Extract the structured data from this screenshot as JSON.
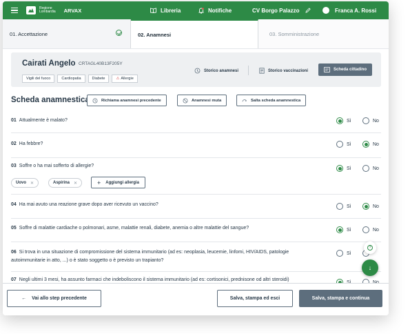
{
  "header": {
    "region_line1": "Regione",
    "region_line2": "Lombardia",
    "app_name": "ARVAX",
    "libreria": "Libreria",
    "notifiche": "Notifiche",
    "cv": "CV Borgo Palazzo",
    "user": "Franca A. Rossi"
  },
  "steps": [
    {
      "label": "01. Accettazione",
      "state": "completed"
    },
    {
      "label": "02. Anamnesi",
      "state": "active"
    },
    {
      "label": "03. Somministrazione",
      "state": "pending"
    }
  ],
  "patient": {
    "name": "Cairati Angelo",
    "code": "CRTAGL40B13F205Y",
    "tags": [
      "Vigili del fuoco",
      "Cardiopatia",
      "Diabete"
    ],
    "alert_tag": "Allergie",
    "links": {
      "storico_anamnesi": "Storico anamnesi",
      "storico_vaccinazioni": "Storico vaccinazioni"
    },
    "scheda_cittadino": "Scheda cittadino"
  },
  "section": {
    "title": "Scheda anamnestica",
    "btn_richiama": "Richiama anamnesi precedente",
    "btn_muta": "Anamnesi muta",
    "btn_salta": "Salta scheda anamnestica"
  },
  "options": {
    "yes": "Sì",
    "no": "No"
  },
  "questions": [
    {
      "num": "01",
      "text": "Attualmente è malato?",
      "answer": "yes"
    },
    {
      "num": "02",
      "text": "Ha febbre?",
      "answer": "no"
    },
    {
      "num": "03",
      "text": "Soffre o ha mai sofferto di allergie?",
      "answer": "yes"
    },
    {
      "num": "04",
      "text": "Ha mai avuto una reazione grave dopo aver ricevuto un vaccino?",
      "answer": "no"
    },
    {
      "num": "05",
      "text": "Soffre di malattie cardiache o polmonari, asme, malattie renali, diabete, anemia o altre malattie del sangue?",
      "answer": "yes"
    },
    {
      "num": "06",
      "text": "Si trova in una situazione di compromissione del sistema immunitario (ad es: neoplasia, leucemie, linfomi, HIV/AIDS, patologie",
      "text2": "autoimmunitarie in atto, ...) o è stato soggetto o è previsto un trapianto?",
      "answer": "none"
    },
    {
      "num": "07",
      "text": "Negli ultimi 3 mesi, ha assunto farmaci che indeboliscono il sistema immunitario (ad es: cortisonici, prednisone od altri steroidi)",
      "answer": "yes"
    }
  ],
  "allergies": [
    "Uovo",
    "Aspirina"
  ],
  "add_allergy": "Aggiungi allergia",
  "footer": {
    "back": "Vai allo step precedente",
    "save": "Salva, stampa ed esci",
    "continue": "Salva, stampa e continua"
  },
  "colors": {
    "primary": "#2d8a46",
    "dark": "#5d6e7d",
    "alert": "#d54c4c"
  }
}
